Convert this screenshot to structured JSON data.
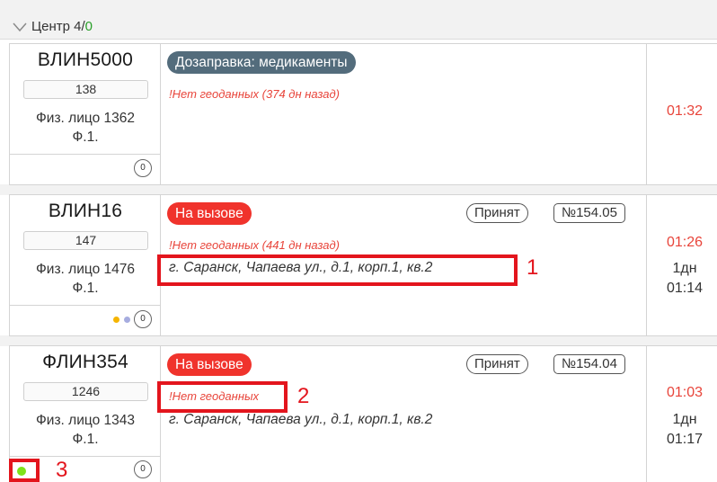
{
  "group": {
    "title": "Центр 4/",
    "count_online": "0"
  },
  "cards": [
    {
      "unit": "ВЛИН5000",
      "number": "138",
      "person_line1": "Физ. лицо 1362",
      "person_line2": "Ф.1.",
      "counter": "0",
      "status": "Дозаправка: медикаменты",
      "geo_warning": "!Нет геоданных (374 дн назад)",
      "time_red": "01:32"
    },
    {
      "unit": "ВЛИН16",
      "number": "147",
      "person_line1": "Физ. лицо 1476",
      "person_line2": "Ф.1.",
      "counter": "0",
      "status": "На вызове",
      "accepted": "Принят",
      "call_number": "№154.05",
      "geo_warning": "!Нет геоданных (441 дн назад)",
      "address": "г. Саранск, Чапаева ул., д.1, корп.1, кв.2",
      "time_red": "01:26",
      "duration_days": "1дн",
      "duration_time": "01:14"
    },
    {
      "unit": "ФЛИН354",
      "number": "1246",
      "person_line1": "Физ. лицо 1343",
      "person_line2": "Ф.1.",
      "counter": "0",
      "status": "На вызове",
      "accepted": "Принят",
      "call_number": "№154.04",
      "geo_warning": "!Нет геоданных",
      "address": "г. Саранск, Чапаева ул., д.1, корп.1, кв.2",
      "time_red": "01:03",
      "duration_days": "1дн",
      "duration_time": "01:17"
    }
  ],
  "annotations": [
    "1",
    "2",
    "3"
  ],
  "colors": {
    "status_gray": "#536c7c",
    "status_red": "#f0332c",
    "warning_red": "#e8443a",
    "annotation_red": "#e3151d",
    "dot_orange": "#f5b400",
    "dot_lavender": "#a6acdf",
    "dot_green": "#7ee21a"
  }
}
